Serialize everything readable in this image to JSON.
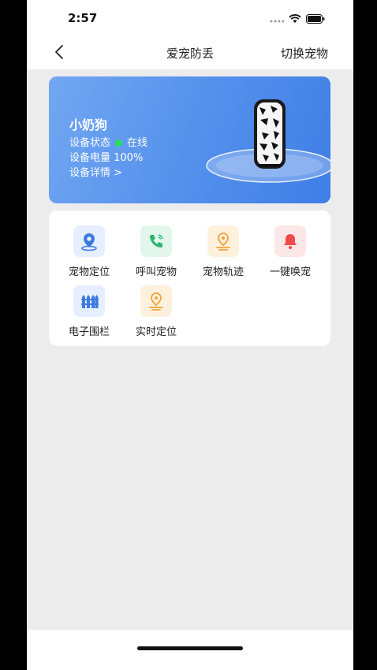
{
  "status_bar": {
    "time": "2:57"
  },
  "nav": {
    "title": "爱宠防丢",
    "switch_label": "切换宠物"
  },
  "device_card": {
    "pet_name": "小奶狗",
    "status_label": "设备状态",
    "status_value": "在线",
    "battery_text": "设备电量 100%",
    "details_link": "设备详情 >",
    "online_color": "#25e05a"
  },
  "functions": [
    {
      "label": "宠物定位",
      "icon": "location-pin-icon",
      "color": "#3d7be0"
    },
    {
      "label": "呼叫宠物",
      "icon": "phone-icon",
      "color": "#2bb673"
    },
    {
      "label": "宠物轨迹",
      "icon": "track-icon",
      "color": "#f0a23a"
    },
    {
      "label": "一键唤宠",
      "icon": "bell-icon",
      "color": "#ef4b4b"
    },
    {
      "label": "电子围栏",
      "icon": "fence-icon",
      "color": "#3d7be0"
    },
    {
      "label": "实时定位",
      "icon": "realtime-location-icon",
      "color": "#f0a23a"
    }
  ]
}
